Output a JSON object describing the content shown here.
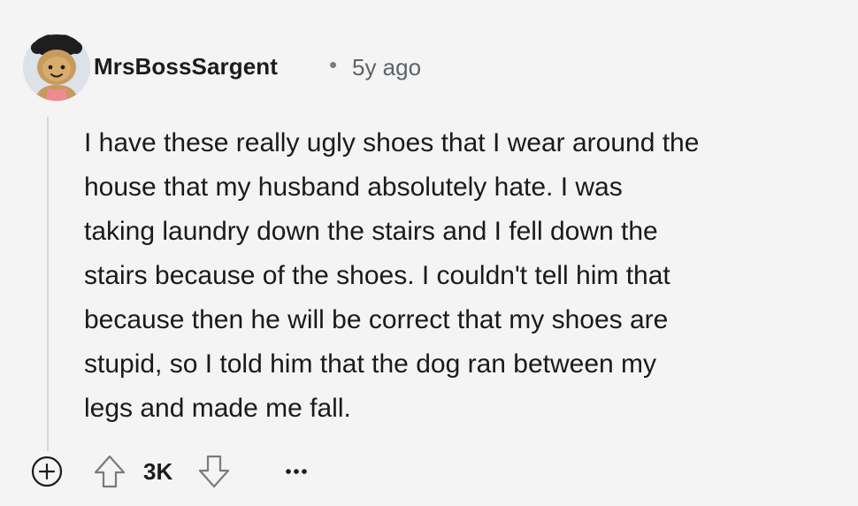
{
  "comment": {
    "author": "MrsBossSargent",
    "separator": "•",
    "age": "5y ago",
    "body_lines": [
      "I have these really ugly shoes that I wear around the",
      "house that my husband absolutely hate. I was",
      "taking laundry down the stairs and I fell down the",
      "stairs because of the shoes. I couldn't tell him that",
      "because then he will be correct that my shoes are",
      "stupid, so I told him that the dog ran between my",
      "legs and made me fall."
    ]
  },
  "actions": {
    "expand_icon": "plus-circle-icon",
    "upvote_icon": "arrow-up-icon",
    "score": "3K",
    "downvote_icon": "arrow-down-icon",
    "more_icon": "ellipsis-icon"
  },
  "colors": {
    "background": "#f4f4f4",
    "text": "#1a1a1b",
    "muted": "#5f6368",
    "thread_line": "#d8d8d8"
  }
}
